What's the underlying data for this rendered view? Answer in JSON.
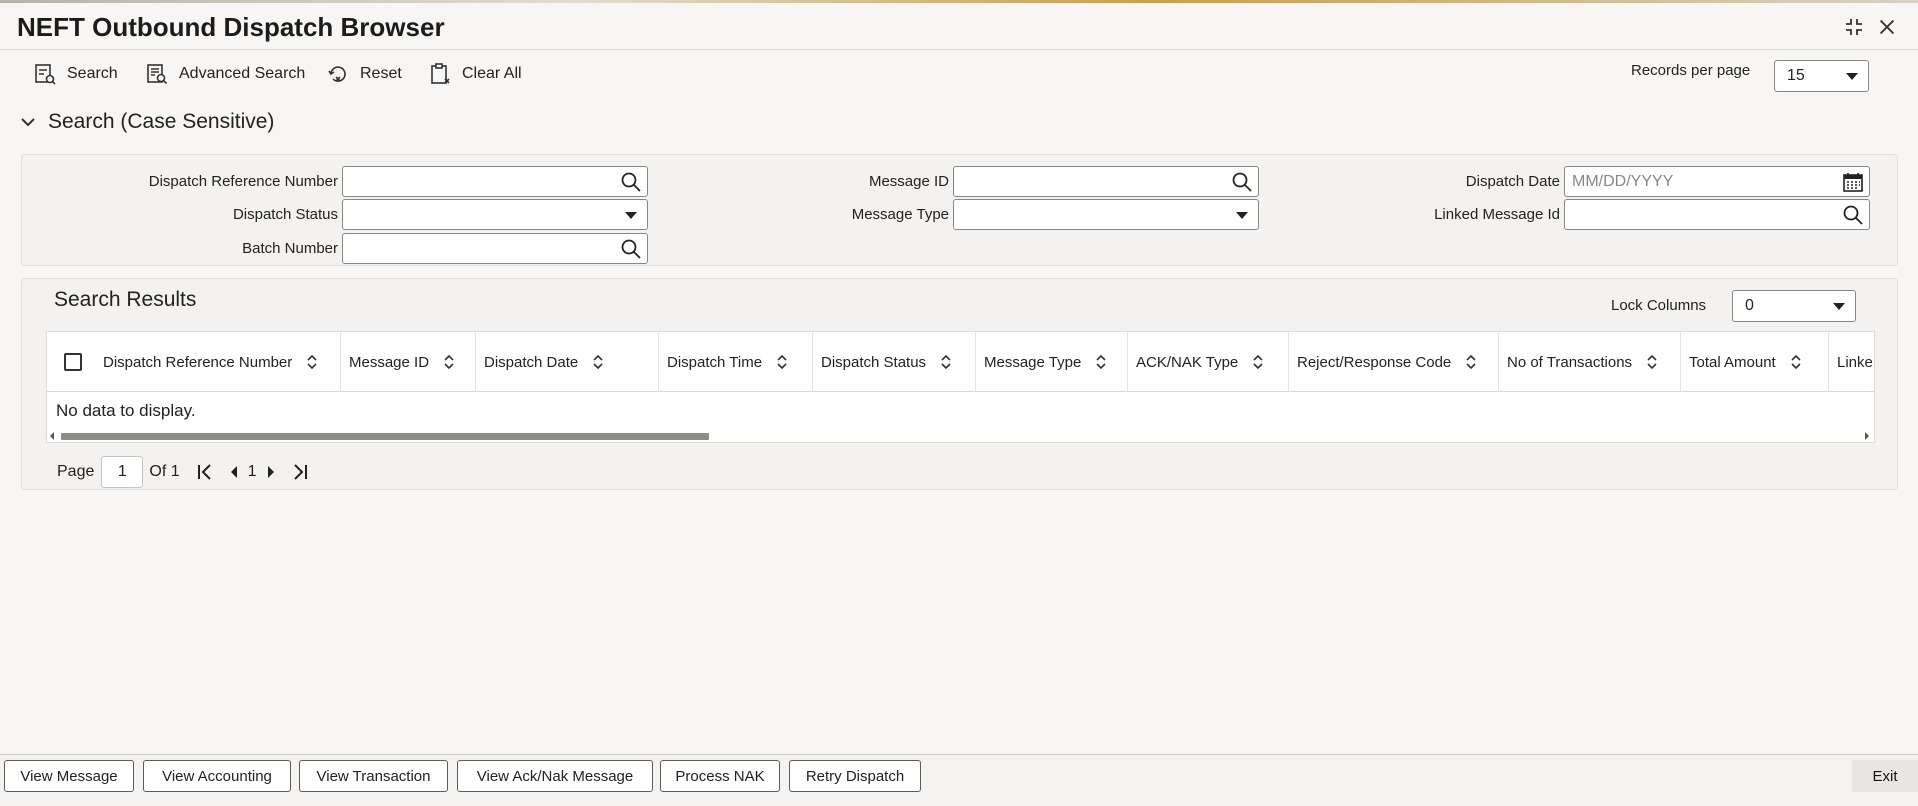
{
  "window": {
    "title": "NEFT Outbound Dispatch Browser"
  },
  "toolbar": {
    "search_label": "Search",
    "advanced_search_label": "Advanced Search",
    "reset_label": "Reset",
    "clear_all_label": "Clear All",
    "records_per_page_label": "Records per page",
    "records_per_page_value": "15"
  },
  "search": {
    "section_title": "Search (Case Sensitive)",
    "fields": {
      "dispatch_reference_number": {
        "label": "Dispatch Reference Number",
        "value": ""
      },
      "dispatch_status": {
        "label": "Dispatch Status",
        "value": ""
      },
      "batch_number": {
        "label": "Batch Number",
        "value": ""
      },
      "message_id": {
        "label": "Message ID",
        "value": ""
      },
      "message_type": {
        "label": "Message Type",
        "value": ""
      },
      "dispatch_date": {
        "label": "Dispatch Date",
        "value": "",
        "placeholder": "MM/DD/YYYY"
      },
      "linked_message_id": {
        "label": "Linked Message Id",
        "value": ""
      }
    }
  },
  "results": {
    "title": "Search Results",
    "lock_columns_label": "Lock Columns",
    "lock_columns_value": "0",
    "columns": [
      "Dispatch Reference Number",
      "Message ID",
      "Dispatch Date",
      "Dispatch Time",
      "Dispatch Status",
      "Message Type",
      "ACK/NAK Type",
      "Reject/Response Code",
      "No of Transactions",
      "Total Amount",
      "Linke"
    ],
    "rows": [],
    "empty_text": "No data to display."
  },
  "pagination": {
    "page_label": "Page",
    "current_page": "1",
    "of_label": "Of 1",
    "page_link": "1"
  },
  "footer": {
    "buttons": [
      "View Message",
      "View Accounting",
      "View Transaction",
      "View Ack/Nak Message",
      "Process NAK",
      "Retry Dispatch"
    ],
    "exit_label": "Exit"
  }
}
